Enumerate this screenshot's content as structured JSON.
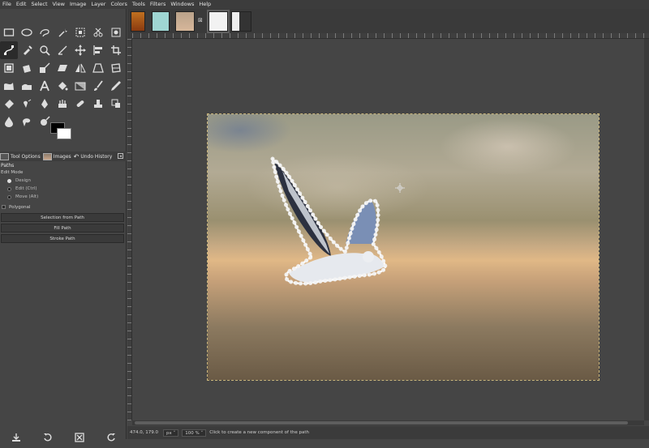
{
  "menu": [
    "File",
    "Edit",
    "Select",
    "View",
    "Image",
    "Layer",
    "Colors",
    "Tools",
    "Filters",
    "Windows",
    "Help"
  ],
  "tools": [
    "rect-select",
    "ellipse-select",
    "free-select",
    "fuzzy-select",
    "select-by-color",
    "scissors-select",
    "foreground-select",
    "paths",
    "color-picker",
    "zoom",
    "measure",
    "move",
    "align",
    "crop",
    "unified-transform",
    "rotate",
    "scale",
    "shear",
    "flip",
    "perspective",
    "cage-transform",
    "warp-transform",
    "handle-transform",
    "text",
    "bucket-fill",
    "gradient",
    "paintbrush",
    "pencil",
    "eraser",
    "airbrush",
    "ink",
    "mypaint-brush",
    "heal",
    "clone",
    "perspective-clone",
    "blur-sharpen",
    "smudge",
    "dodge-burn"
  ],
  "dock": {
    "tabs": [
      "Tool Options",
      "Images",
      "Undo History"
    ],
    "menu_icon": "dock-menu-icon"
  },
  "tool_options": {
    "title": "Paths",
    "edit_mode_label": "Edit Mode",
    "modes": [
      "Design",
      "Edit (Ctrl)",
      "Move (Alt)"
    ],
    "selected_mode": "Design",
    "polygonal": "Polygonal",
    "buttons": [
      "Selection from Path",
      "Fill Path",
      "Stroke Path"
    ]
  },
  "bottom_icons": [
    "save-preset-icon",
    "restore-icon",
    "delete-icon",
    "reset-icon"
  ],
  "image_tabs": [
    "person-silhouette-thumb",
    "bird-cutout-thumb",
    "bird-photo-thumb",
    "dark-image-thumb",
    "bird-dark-thumb"
  ],
  "statusbar": {
    "coords": "474.0, 179.0",
    "unit": "px",
    "zoom": "100 %",
    "message": "Click to create a new component of the path"
  },
  "colors": {
    "foreground": "#000000",
    "background": "#ffffff",
    "path_node": "#ffffff",
    "selection_outline": "#c8b47a"
  }
}
